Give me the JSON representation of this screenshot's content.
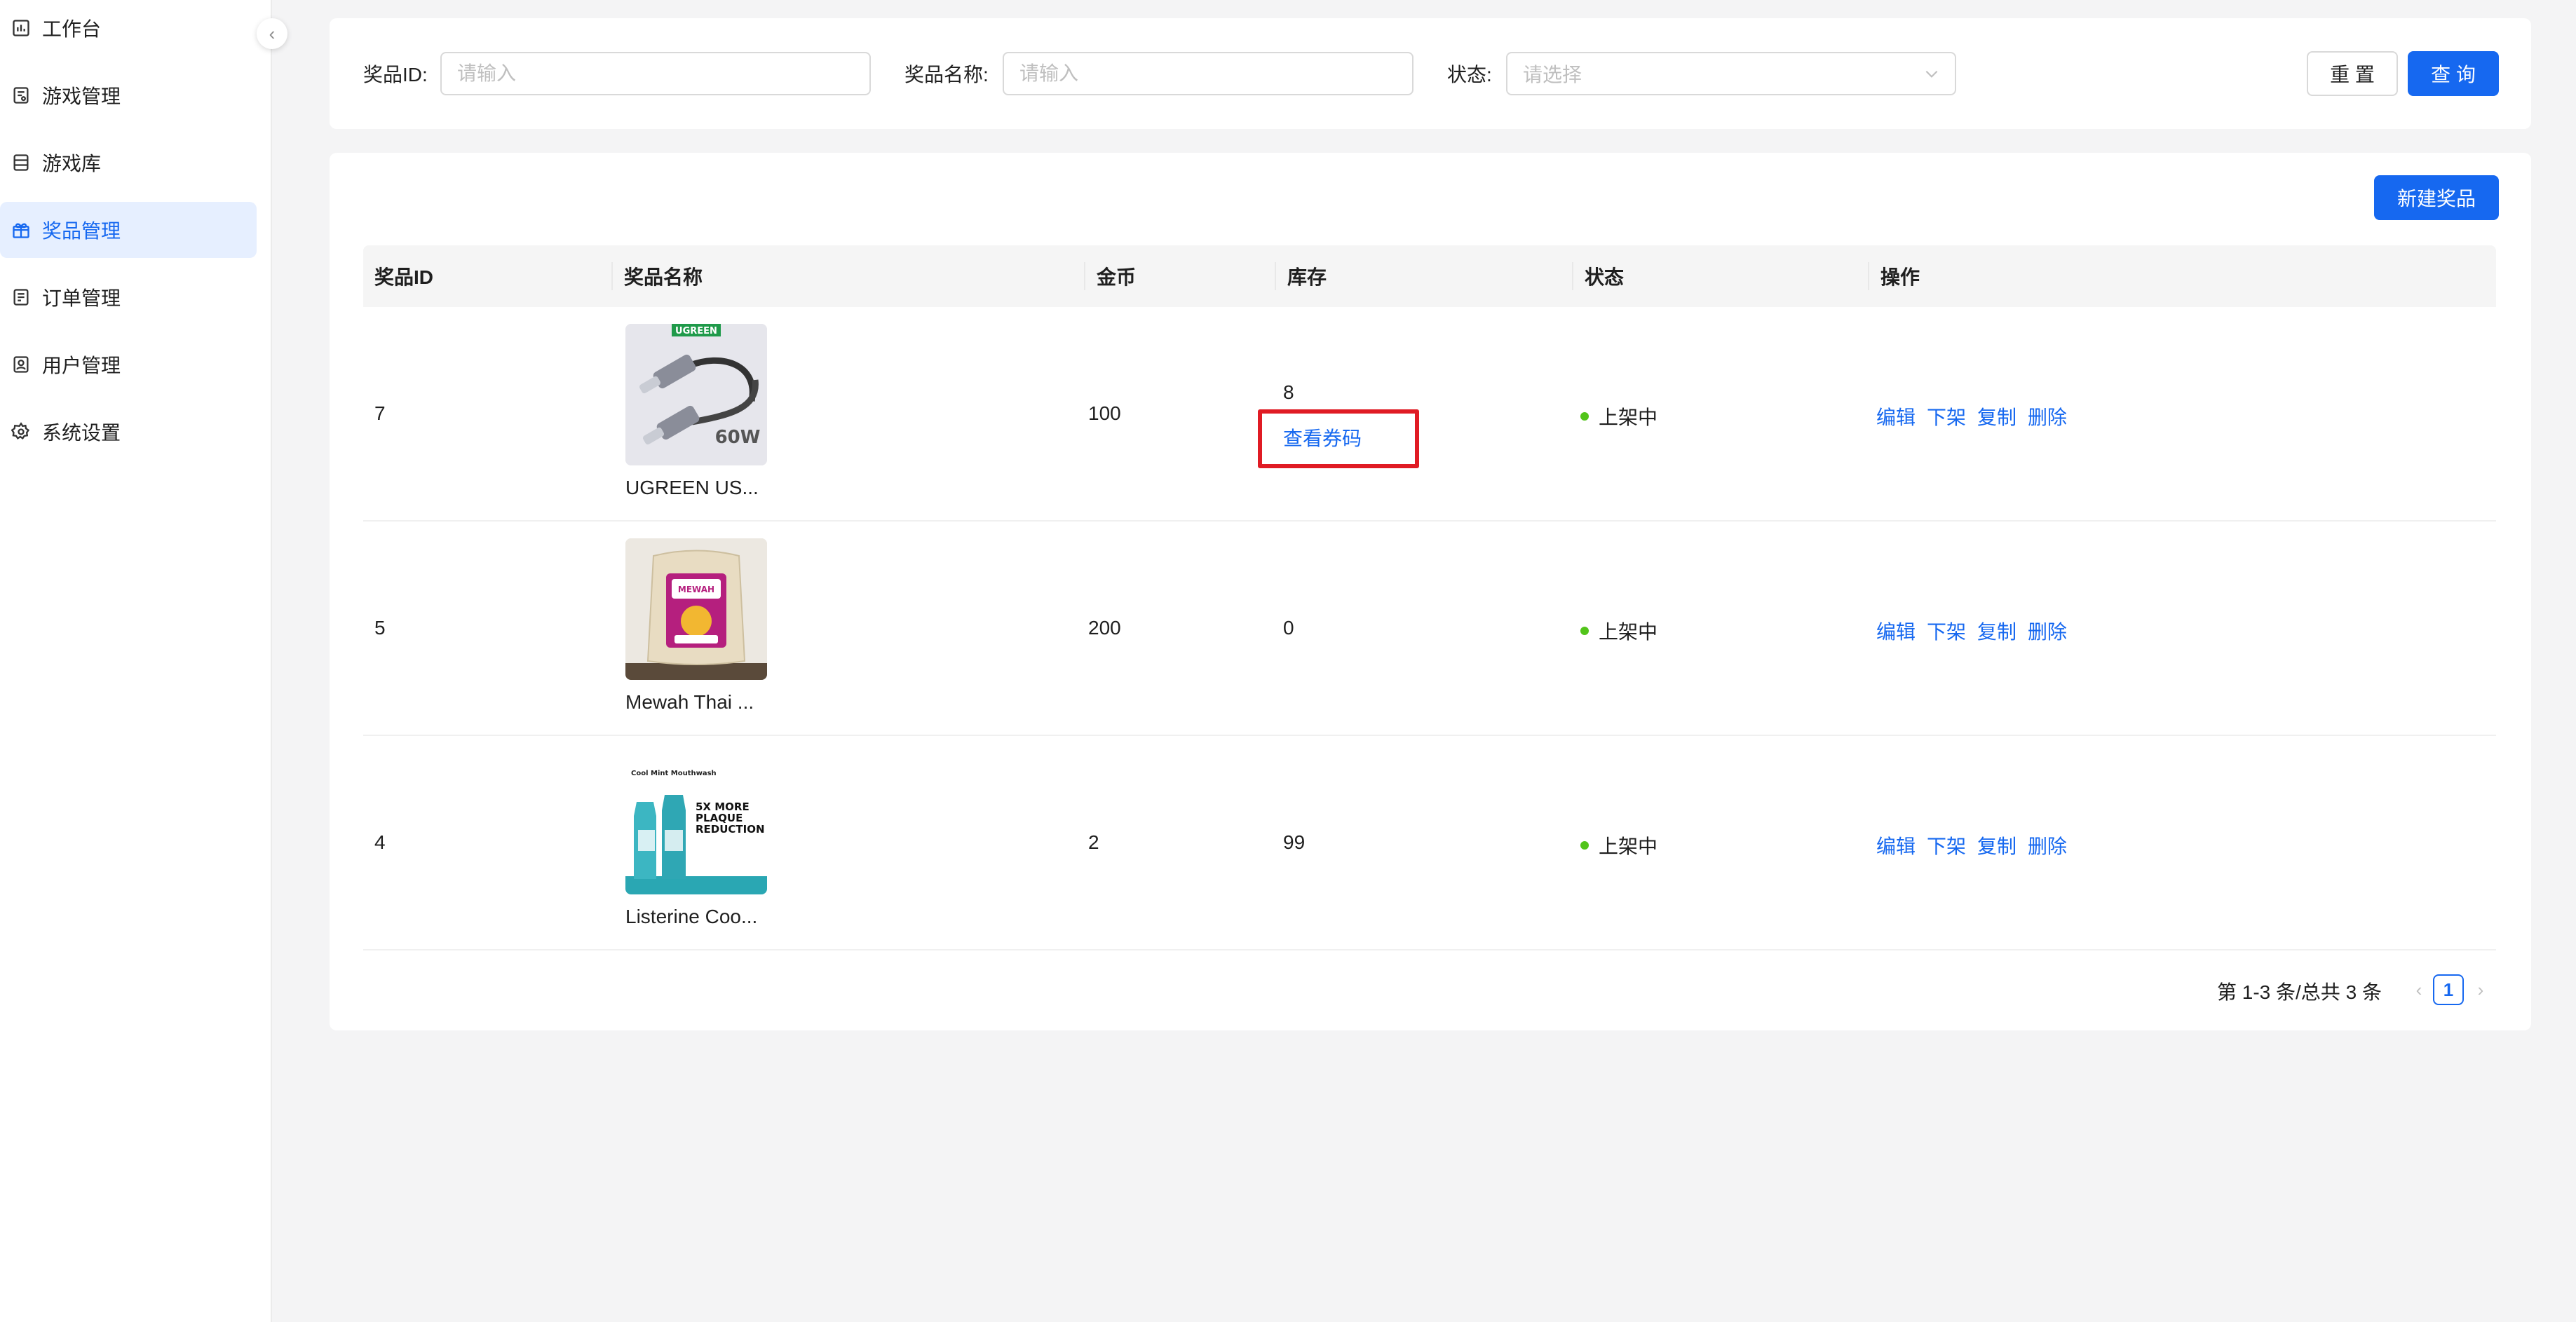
{
  "sidebar": {
    "items": [
      {
        "label": "工作台",
        "icon": "dashboard-icon"
      },
      {
        "label": "游戏管理",
        "icon": "game-management-icon"
      },
      {
        "label": "游戏库",
        "icon": "game-library-icon"
      },
      {
        "label": "奖品管理",
        "icon": "gift-icon",
        "active": true
      },
      {
        "label": "订单管理",
        "icon": "order-icon"
      },
      {
        "label": "用户管理",
        "icon": "user-icon"
      },
      {
        "label": "系统设置",
        "icon": "settings-icon"
      }
    ]
  },
  "filters": {
    "prize_id": {
      "label": "奖品ID:",
      "placeholder": "请输入",
      "value": ""
    },
    "prize_name": {
      "label": "奖品名称:",
      "placeholder": "请输入",
      "value": ""
    },
    "status": {
      "label": "状态:",
      "placeholder": "请选择"
    },
    "reset_label": "重 置",
    "query_label": "查 询"
  },
  "toolbar": {
    "new_prize_label": "新建奖品"
  },
  "table": {
    "columns": [
      "奖品ID",
      "奖品名称",
      "金币",
      "库存",
      "状态",
      "操作"
    ],
    "rows": [
      {
        "id": "7",
        "name": "UGREEN US...",
        "coins": "100",
        "stock": "8",
        "stock_link": "查看券码",
        "status": "上架中",
        "image_label": "UGREEN",
        "image_badge": "60W"
      },
      {
        "id": "5",
        "name": "Mewah Thai ...",
        "coins": "200",
        "stock": "0",
        "status": "上架中",
        "image_label": "MEWAH"
      },
      {
        "id": "4",
        "name": "Listerine Coo...",
        "coins": "2",
        "stock": "99",
        "status": "上架中",
        "image_label": "5X MORE PLAQUE REDUCTION",
        "image_caption": "Cool Mint Mouthwash"
      }
    ],
    "actions": [
      "编辑",
      "下架",
      "复制",
      "删除"
    ]
  },
  "pagination": {
    "summary": "第 1-3 条/总共 3 条",
    "current_page": "1"
  },
  "colors": {
    "primary": "#1668f0",
    "success": "#52c41a",
    "highlight": "#e01b24",
    "background": "#f4f4f5"
  }
}
